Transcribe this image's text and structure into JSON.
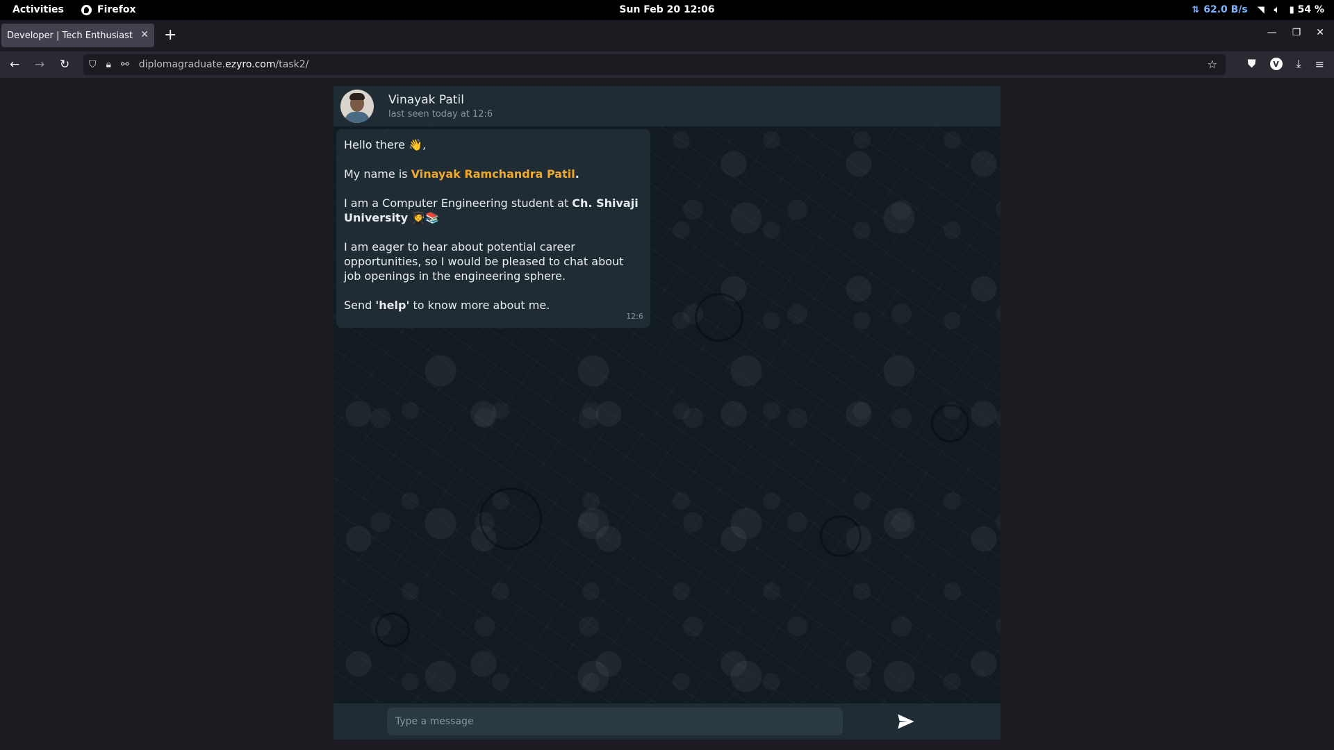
{
  "system": {
    "activities": "Activities",
    "app_name": "Firefox",
    "clock": "Sun Feb 20  12:06",
    "network_speed": "62.0 B/s",
    "battery": "54 %"
  },
  "browser": {
    "tab_title": "Developer | Tech Enthusiast |",
    "url_prefix": "diplomagraduate.",
    "url_domain": "ezyro.com",
    "url_path": "/task2/",
    "profile_initial": "V"
  },
  "chat": {
    "contact_name": "Vinayak Patil",
    "last_seen": "last seen today at 12:6",
    "message": {
      "greeting": "Hello there 👋,",
      "name_prefix": "My name is ",
      "name_highlight": "Vinayak Ramchandra Patil",
      "name_suffix": ".",
      "study_prefix": "I am a Computer Engineering student at ",
      "university": "Ch. Shivaji University",
      "study_emoji": " 🧑‍🎓📚",
      "career": "I am eager to hear about potential career opportunities, so I would be pleased to chat about job openings in the engineering sphere.",
      "help_prefix": "Send ",
      "help_keyword": "'help'",
      "help_suffix": " to know more about me.",
      "time": "12:6"
    },
    "input_placeholder": "Type a message"
  },
  "colors": {
    "highlight": "#f0a92c",
    "bubble": "#202c33",
    "chat_bg": "#111b21"
  }
}
